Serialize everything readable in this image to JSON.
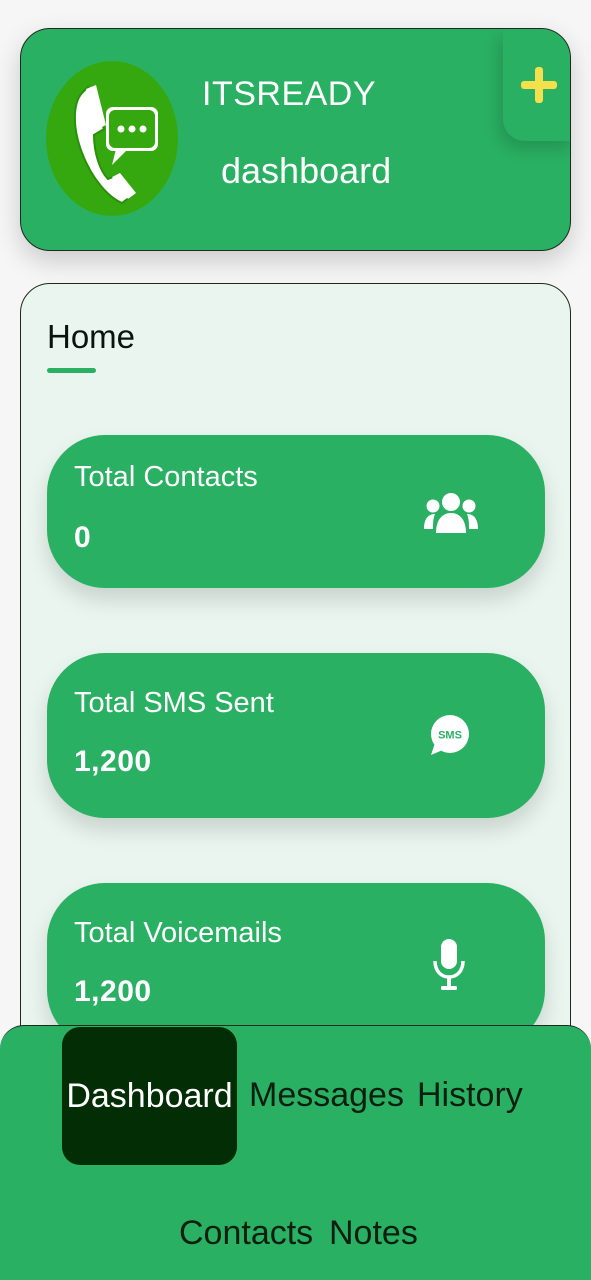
{
  "header": {
    "app_name": "ITSREADY",
    "subtitle": "dashboard",
    "add_icon": "plus-icon",
    "logo_icon": "phone-chat-icon"
  },
  "main": {
    "section_title": "Home",
    "stats": [
      {
        "label": "Total Contacts",
        "value": "0",
        "icon": "users-icon"
      },
      {
        "label": "Total SMS Sent",
        "value": "1,200",
        "icon": "sms-icon"
      },
      {
        "label": "Total Voicemails",
        "value": "1,200",
        "icon": "microphone-icon"
      }
    ]
  },
  "bottom_nav": {
    "items": [
      {
        "label": "Dashboard",
        "active": true
      },
      {
        "label": "Messages",
        "active": false
      },
      {
        "label": "History",
        "active": false
      },
      {
        "label": "Contacts",
        "active": false
      },
      {
        "label": "Notes",
        "active": false
      }
    ]
  },
  "colors": {
    "primary_green": "#2ab063",
    "logo_green": "#36a80f",
    "active_tab": "#032d05",
    "add_icon_yellow": "#f4e04d",
    "content_background": "#e9f5ee"
  }
}
